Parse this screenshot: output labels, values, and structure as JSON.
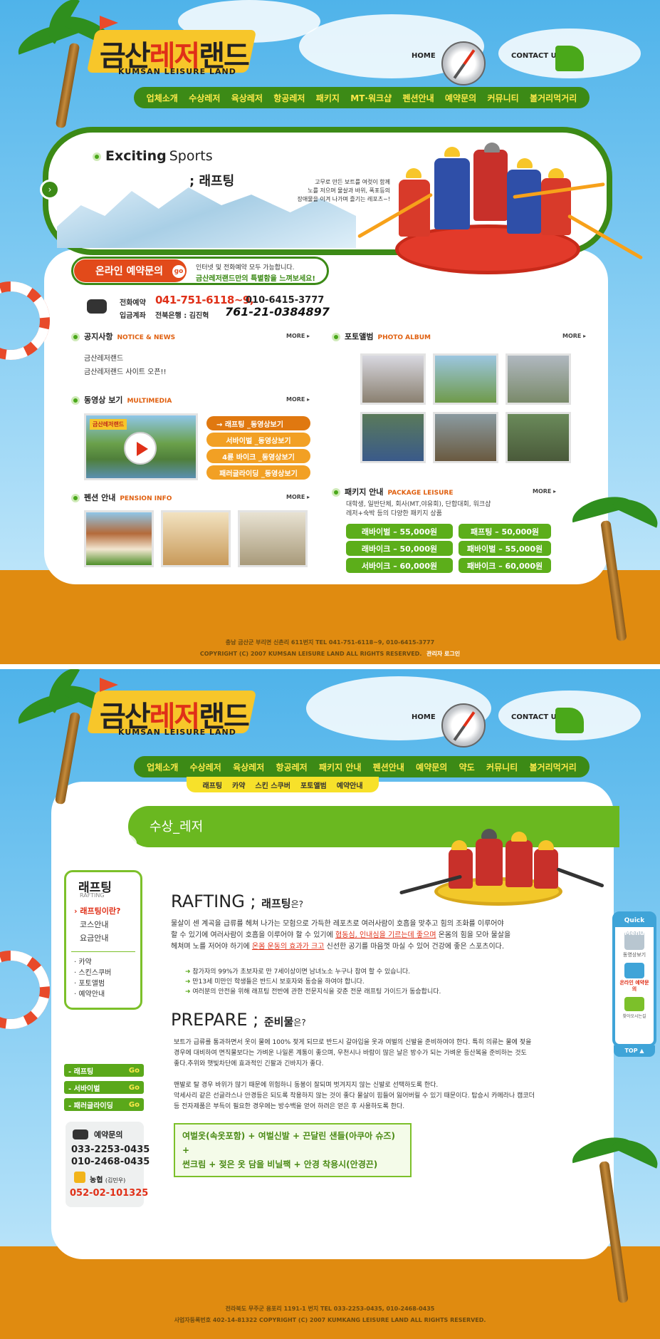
{
  "colors": {
    "brand_green": "#3c8a16",
    "accent_yellow": "#fde94a",
    "accent_orange": "#e06010",
    "sand": "#e08b10",
    "sky": "#4fb3ea"
  },
  "logo": {
    "korean_a": "금산",
    "korean_b": "레저",
    "korean_c": "랜드",
    "english": "KUMSAN LEISURE LAND"
  },
  "top_links": {
    "home": "HOME",
    "contact": "CONTACT US"
  },
  "main_nav_1": [
    "업체소개",
    "수상레저",
    "육상레저",
    "항공레저",
    "패키지",
    "MT·워크샵",
    "펜션안내",
    "예약문의",
    "커뮤니티",
    "볼거리먹거리"
  ],
  "main_nav_2": [
    "업체소개",
    "수상레저",
    "육상레저",
    "항공레저",
    "패키지 안내",
    "펜션안내",
    "예약문의",
    "약도",
    "커뮤니티",
    "볼거리먹거리"
  ],
  "sub_nav_2": [
    "래프팅",
    "카약",
    "스킨 스쿠버",
    "포토앨범",
    "예약안내"
  ],
  "hero": {
    "title_bold": "Exciting",
    "title_light": "Sports",
    "activity": "; 래프팅",
    "desc": [
      "고무로 만든 보트를 여럿이 함께",
      "노를 저으며 물살과 바위, 폭포등의",
      "장애물을 이겨 나가며 즐기는 레포츠~!"
    ]
  },
  "reservation": {
    "title": "온라인 예약문의",
    "go": "go",
    "line1": "인터넷 및 전화예약 모두 가능합니다.",
    "line2": "금산레저랜드만의 특별함을 느껴보세요!",
    "phone_label": "전화예약",
    "phone_main": "041-751-6118~9,",
    "phone_alt": "010-6415-3777",
    "bank_label": "입금계좌",
    "bank_name": "전북은행 : 김진혁",
    "account": "761-21-0384897"
  },
  "notice": {
    "title": "공지사항",
    "en": "NOTICE & NEWS",
    "more": "MORE ▸",
    "items": [
      "금산레저랜드",
      "금산레저랜드 사이트 오픈!!"
    ]
  },
  "multimedia": {
    "title": "동영상 보기",
    "en": "MULTIMEDIA",
    "more": "MORE ▸",
    "video_caption": "금산레저랜드",
    "buttons": [
      "→ 래프팅 _동영상보기",
      "서바이벌 _동영상보기",
      "4륜 바이크 _동영상보기",
      "패러글라이딩 _동영상보기"
    ]
  },
  "pension": {
    "title": "펜션 안내",
    "en": "PENSION INFO",
    "more": "MORE ▸"
  },
  "photo": {
    "title": "포토앨범",
    "en": "PHOTO ALBUM",
    "more": "MORE ▸"
  },
  "package": {
    "title": "패키지 안내",
    "en": "PACKAGE LEISURE",
    "more": "MORE ▸",
    "desc1": "대학생, 일반단체, 회사(MT,야유회), 단합대회, 워크샵",
    "desc2": "레저+숙박 등의 다양한 패키지 상품",
    "items": [
      "래바이벌 – 55,000원",
      "패프팅 – 50,000원",
      "래바이크 – 50,000원",
      "패바이벌 – 55,000원",
      "서바이크 – 60,000원",
      "패바이크 – 60,000원"
    ]
  },
  "footer_1": {
    "address": "충남 금산군 부리면 신촌리 611번지 TEL 041-751-6118~9, 010-6415-3777",
    "copyright": "COPYRIGHT (C) 2007 KUMSAN LEISURE LAND ALL RIGHTS RESERVED.",
    "admin": "관리자 로그인"
  },
  "page2": {
    "section_title": "수상_레저",
    "left": {
      "title": "래프팅",
      "title_en": "RAFTING",
      "items": [
        "› 래프팅이란?",
        "코스안내",
        "요금안내"
      ],
      "sub": [
        "· 카약",
        "· 스킨스쿠버",
        "· 포토앨범",
        "· 예약안내"
      ]
    },
    "left_buttons": [
      {
        "label": "- 래프팅",
        "go": "Go"
      },
      {
        "label": "- 서바이벌",
        "go": "Go"
      },
      {
        "label": "- 패러글라이딩",
        "go": "Go"
      }
    ],
    "contact": {
      "title": "예약문의",
      "phone1": "033-2253-0435",
      "phone2": "010-2468-0435",
      "bank": "농협",
      "holder": "(김민우)",
      "account": "052-02-101325"
    },
    "rafting_title": "RAFTING ;",
    "rafting_kor": "래프팅",
    "rafting_q": "은?",
    "rafting_p": [
      "물살이 센 계곡을 급류를 헤쳐 나가는 모험으로 가득한 레포츠로 여러사람이 호흡을 맞추고 힘의 조화를 이루어야",
      "할 수 있기에 여러사람이 호흡을 이루어야 할 수 있기에 ",
      "협동심, 인내심을 기르는데 좋으며",
      " 온몸의 힘을 모아 물살을",
      "헤쳐며 노를 저어야 하기에 ",
      "온몸 운동의 효과가 크고",
      " 신선한 공기를 마음껏 마실 수 있어 건강에 좋은 스포츠이다."
    ],
    "bullets": [
      "참가자의 99%가 초보자로 만 7세이상이면 남녀노소 누구나 참여 할 수 있습니다.",
      "만13세 미만인 학생들은 반드시 보호자와 동승을 하여야 합니다.",
      "여러분의 안전을 위해 래프팅 전반에 관한 전문지식을 갖춘 전문 래프팅 가이드가 동승합니다."
    ],
    "prepare_title": "PREPARE ;",
    "prepare_kor": "준비물",
    "prepare_q": "은?",
    "prepare_p1": [
      "보트가 급류를 통과하면서 옷이 물에 100% 젖게 되므로 반드시 갈아입을 옷과 여벌의 신발을 준비하여야 한다. 특히 의류는 물에 젖을",
      "경우에 대비하여 면직물보다는 가벼운 나일론 계통이 좋으며, 우천시나 바람이 많은 날은 방수가 되는 가벼운 등산복을 준비하는 것도",
      "좋다.추위와 햇빛차단에 효과적인 긴팔과 긴바지가 좋다."
    ],
    "prepare_p2": [
      "맨발로 탈 경우 바위가 많기 때문에 위험하니 동봉이 잘되며 벗겨지지 않는 신발로 선택하도록 한다.",
      "악세사리 같은 선글라스나 안경등은 되도록 착용하지 않는 것이 좋다 물살이 힘들어 잃어버릴 수 있기 때문이다. 탑승시 카메라나 캠코더",
      "등 전자제품은 부득이 필요한 경우에는 방수백을 얻어 하려은 얻은 후 사용하도록 한다."
    ],
    "items_line1": "여벌옷(속옷포함) + 여벌신발 + 끈달린 샌들(아쿠아 슈즈) +",
    "items_line2": "썬크림 + 젖은 옷 담을 비닐팩 + 안경 착용시(안경끈)",
    "quick": {
      "title": "Quick Menu",
      "video": "동영상보기",
      "reserve": "온라인 예약문의",
      "tour": "찾아오시는길",
      "top": "TOP ▲"
    },
    "footer": {
      "address": "전라북도 무주군 용포리 1191-1 번지 TEL 033-2253-0435, 010-2468-0435",
      "copyright": "사업자등록번호 402-14-81322 COPYRIGHT (C) 2007 KUMKANG LEISURE LAND ALL RIGHTS RESERVED."
    }
  }
}
